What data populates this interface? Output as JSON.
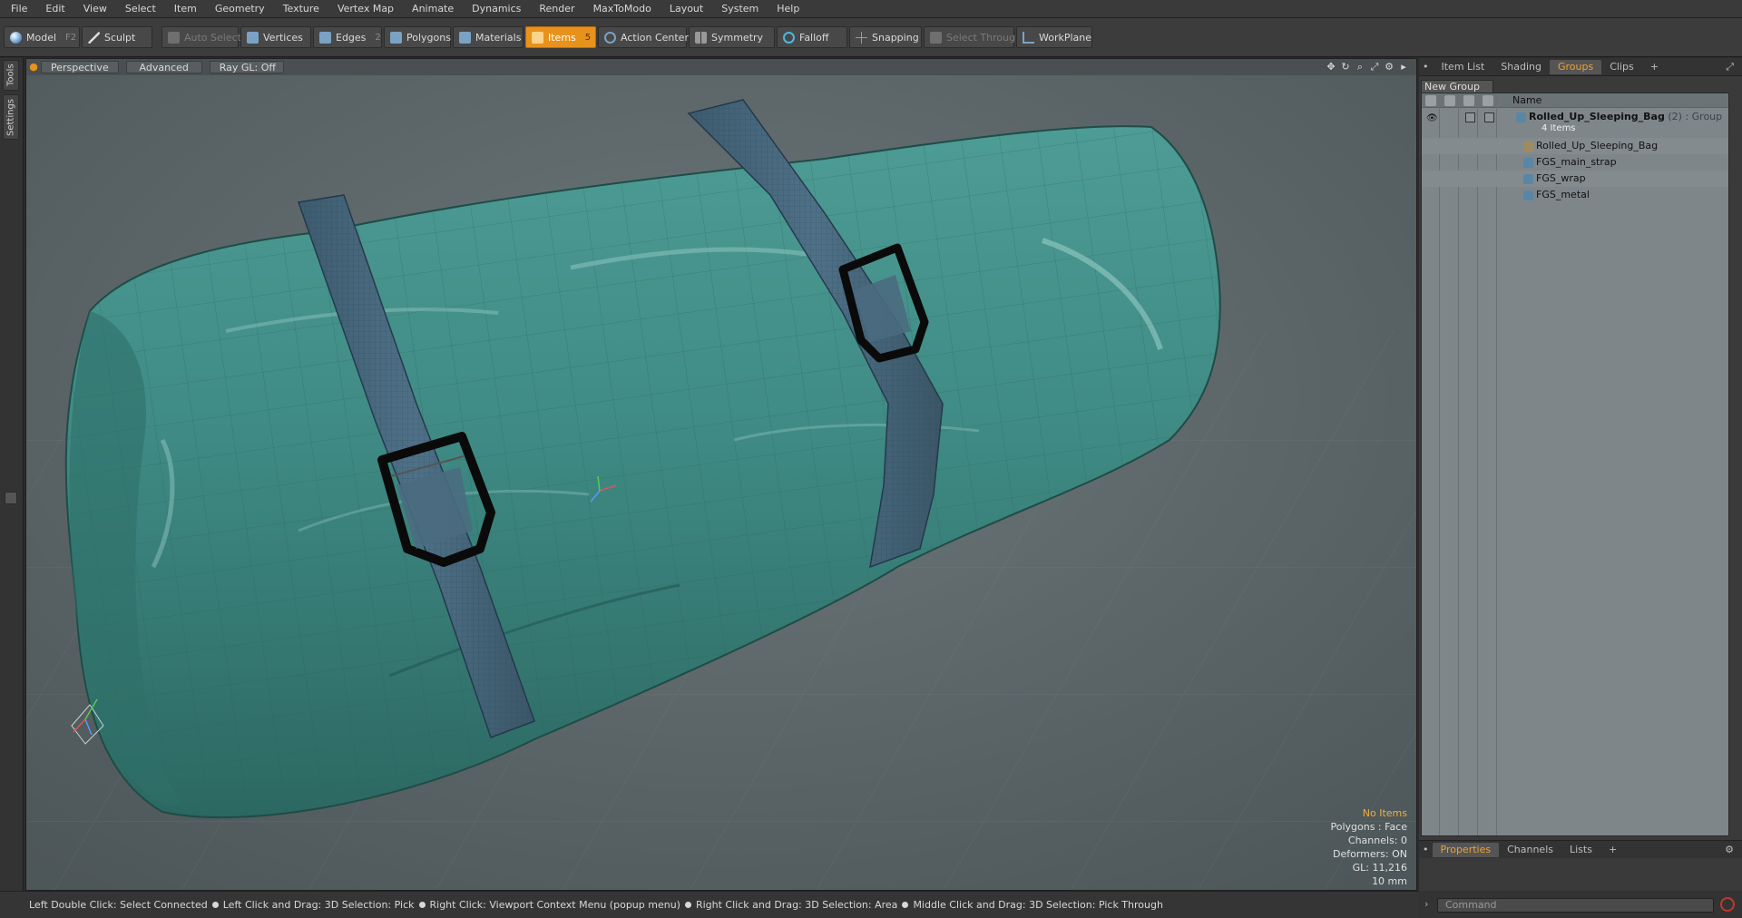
{
  "menu": [
    "File",
    "Edit",
    "View",
    "Select",
    "Item",
    "Geometry",
    "Texture",
    "Vertex Map",
    "Animate",
    "Dynamics",
    "Render",
    "MaxToModo",
    "Layout",
    "System",
    "Help"
  ],
  "toolbar": {
    "model": "Model",
    "model_key": "F2",
    "sculpt": "Sculpt",
    "auto_select": "Auto Select",
    "vertices": "Vertices",
    "vertices_key": "1",
    "edges": "Edges",
    "edges_key": "2",
    "polygons": "Polygons",
    "materials": "Materials",
    "items": "Items",
    "items_key": "5",
    "action_center": "Action Center",
    "symmetry": "Symmetry",
    "falloff": "Falloff",
    "snapping": "Snapping",
    "select_through": "Select Through",
    "workplane": "WorkPlane"
  },
  "left_tabs": [
    "Tools",
    "Settings"
  ],
  "viewport": {
    "view": "Perspective",
    "shading": "Advanced",
    "raygl": "Ray GL: Off",
    "stats": {
      "selection": "No Items",
      "polygons": "Polygons : Face",
      "channels": "Channels: 0",
      "deformers": "Deformers: ON",
      "gl": "GL: 11,216",
      "scale": "10 mm"
    }
  },
  "right_panel": {
    "tabs": [
      "Item List",
      "Shading",
      "Groups",
      "Clips",
      "+"
    ],
    "active_tab": "Groups",
    "new_group": "New Group",
    "name_header": "Name",
    "group_name": "Rolled_Up_Sleeping_Bag",
    "group_suffix": "(2) : Group",
    "group_count": "4 Items",
    "children": [
      "Rolled_Up_Sleeping_Bag",
      "FGS_main_strap",
      "FGS_wrap",
      "FGS_metal"
    ]
  },
  "bottom_panel": {
    "tabs": [
      "Properties",
      "Channels",
      "Lists",
      "+"
    ],
    "command_placeholder": "Command"
  },
  "status": {
    "items": [
      "Left Double Click: Select Connected",
      "Left Click and Drag: 3D Selection: Pick",
      "Right Click: Viewport Context Menu (popup menu)",
      "Right Click and Drag: 3D Selection: Area",
      "Middle Click and Drag: 3D Selection: Pick Through"
    ]
  },
  "colors": {
    "accent": "#e8921c",
    "bag": "#3f8a84",
    "strap": "#45657a",
    "viewport_bg": "#5c6668"
  }
}
